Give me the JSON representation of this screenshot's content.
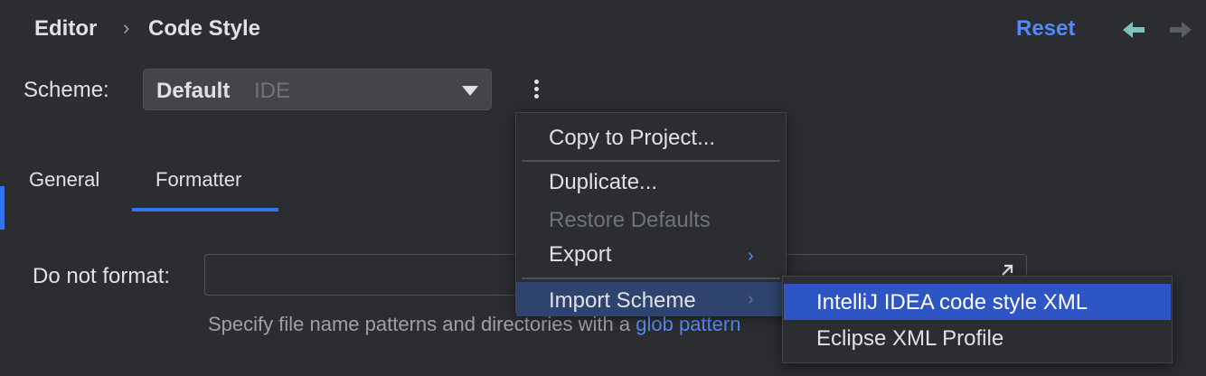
{
  "breadcrumb": {
    "parent": "Editor",
    "separator": "›",
    "current": "Code Style"
  },
  "header": {
    "reset_label": "Reset",
    "back_icon": "arrow-left-icon",
    "forward_icon": "arrow-right-icon"
  },
  "scheme": {
    "label": "Scheme:",
    "name": "Default",
    "tag": "IDE"
  },
  "tabs": [
    {
      "label": "General",
      "selected": false
    },
    {
      "label": "Formatter",
      "selected": true
    }
  ],
  "do_not_format": {
    "label": "Do not format:",
    "value": "",
    "hint_prefix": "Specify file name patterns and directories with a",
    "hint_link": "glob pattern"
  },
  "menu": {
    "items": [
      {
        "label": "Copy to Project...",
        "enabled": true
      },
      {
        "label": "Duplicate...",
        "enabled": true
      },
      {
        "label": "Restore Defaults",
        "enabled": false
      },
      {
        "label": "Export",
        "enabled": true,
        "has_submenu": true
      },
      {
        "label": "Import Scheme",
        "enabled": true,
        "has_submenu": true,
        "highlighted": true
      }
    ]
  },
  "submenu": {
    "items": [
      {
        "label": "IntelliJ IDEA code style XML",
        "highlighted": true
      },
      {
        "label": "Eclipse XML Profile",
        "highlighted": false
      }
    ]
  },
  "colors": {
    "background": "#2b2d30",
    "accent": "#3574f0",
    "link": "#548af7",
    "selection": "#2e55c4",
    "back_arrow": "#7cc3c0"
  }
}
